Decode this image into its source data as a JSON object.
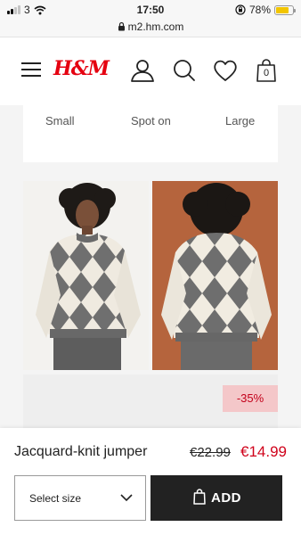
{
  "status_bar": {
    "carrier": "3",
    "time": "17:50",
    "battery_percent": "78%",
    "battery_level": 0.78,
    "battery_color": "#f2c500"
  },
  "browser": {
    "url": "m2.hm.com",
    "lock_icon": "lock-icon"
  },
  "header": {
    "menu_icon": "hamburger-menu-icon",
    "logo_text": "H&M",
    "logo_color": "#e50010",
    "account_icon": "user-icon",
    "search_icon": "search-icon",
    "favorites_icon": "heart-icon",
    "bag_icon": "shopping-bag-icon",
    "bag_count": "0"
  },
  "fit": {
    "options": [
      "Small",
      "Spot on",
      "Large"
    ]
  },
  "gallery": {
    "discount_badge": "-35%",
    "discount_color": "#c3001a"
  },
  "product": {
    "name": "Jacquard-knit jumper",
    "old_price": "€22.99",
    "new_price": "€14.99",
    "price_color": "#d0021b"
  },
  "purchase": {
    "size_select_label": "Select size",
    "add_button_label": "ADD"
  }
}
